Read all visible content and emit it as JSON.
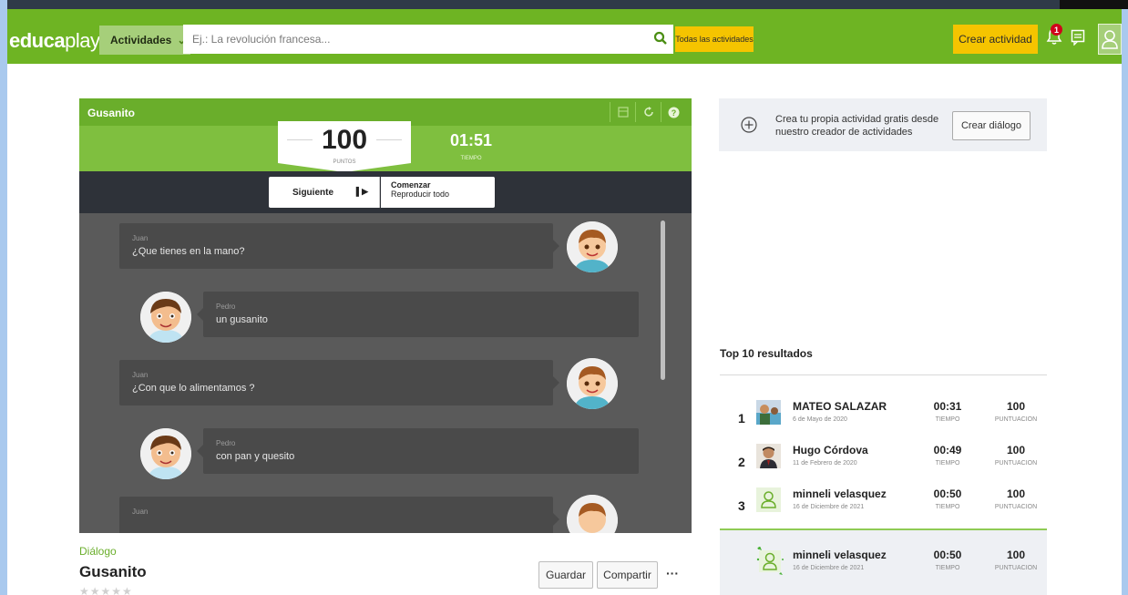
{
  "nav": {
    "logo_bold": "educa",
    "logo_thin": "play",
    "activities_label": "Actividades",
    "search_placeholder": "Ej.: La revolución francesa...",
    "all_activities_label": "Todas las actividades",
    "create_activity_label": "Crear actividad",
    "notification_count": "1"
  },
  "game": {
    "title": "Gusanito",
    "points_value": "100",
    "points_label": "PUNTOS",
    "time_value": "01:51",
    "time_label": "TIEMPO",
    "next_label": "Siguiente",
    "start_label": "Comenzar",
    "replay_label": "Reproducir todo",
    "messages": [
      {
        "speaker": "Juan",
        "text": "¿Que tienes en la mano?"
      },
      {
        "speaker": "Pedro",
        "text": "un gusanito"
      },
      {
        "speaker": "Juan",
        "text": "¿Con que lo alimentamos ?"
      },
      {
        "speaker": "Pedro",
        "text": "con pan y quesito"
      },
      {
        "speaker": "Juan",
        "text": ""
      }
    ]
  },
  "activity": {
    "type": "Diálogo",
    "title": "Gusanito",
    "rating_stars": "★★★★★",
    "save_label": "Guardar",
    "share_label": "Compartir",
    "more_label": "···"
  },
  "promo": {
    "text": "Crea tu propia actividad gratis desde nuestro creador de actividades",
    "button_label": "Crear diálogo"
  },
  "leaderboard": {
    "title": "Top 10 resultados",
    "time_label": "TIEMPO",
    "score_label": "PUNTUACION",
    "rows": [
      {
        "rank": "1",
        "name": "MATEO SALAZAR",
        "date": "6 de Mayo de 2020",
        "time": "00:31",
        "score": "100"
      },
      {
        "rank": "2",
        "name": "Hugo Córdova",
        "date": "11 de Febrero de 2020",
        "time": "00:49",
        "score": "100"
      },
      {
        "rank": "3",
        "name": "minneli velasquez",
        "date": "16 de Diciembre de 2021",
        "time": "00:50",
        "score": "100"
      }
    ],
    "mine": {
      "name": "minneli velasquez",
      "date": "16 de Diciembre de 2021",
      "time": "00:50",
      "score": "100"
    }
  },
  "colors": {
    "brand_green": "#6eb423",
    "yellow": "#f5c400",
    "dark_panel": "#2e3239"
  }
}
